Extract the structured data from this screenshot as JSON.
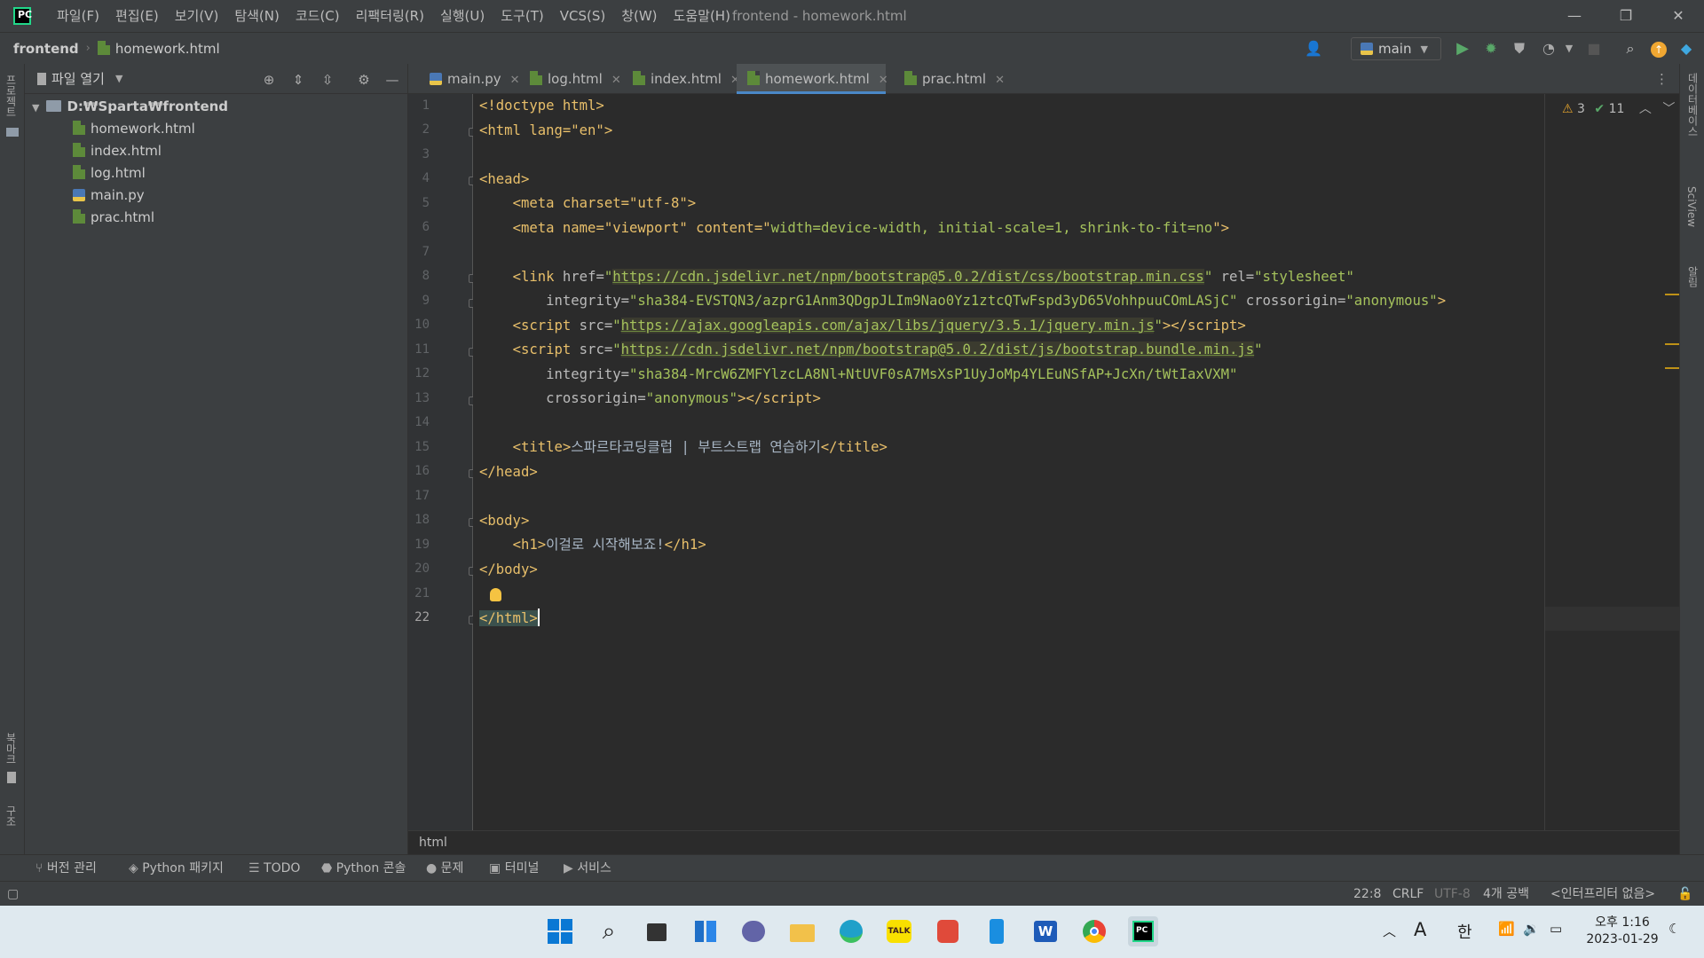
{
  "app": {
    "menu": [
      "파일(F)",
      "편집(E)",
      "보기(V)",
      "탐색(N)",
      "코드(C)",
      "리팩터링(R)",
      "실행(U)",
      "도구(T)",
      "VCS(S)",
      "창(W)",
      "도움말(H)"
    ],
    "window_title": "frontend - homework.html"
  },
  "navbar": {
    "project": "frontend",
    "file": "homework.html",
    "run_config": "main"
  },
  "project_panel": {
    "title": "파일 열기",
    "root": "D:₩Sparta₩frontend",
    "files": [
      "homework.html",
      "index.html",
      "log.html",
      "main.py",
      "prac.html"
    ]
  },
  "tabs": [
    {
      "label": "main.py",
      "type": "py"
    },
    {
      "label": "log.html",
      "type": "html"
    },
    {
      "label": "index.html",
      "type": "html"
    },
    {
      "label": "homework.html",
      "type": "html",
      "active": true
    },
    {
      "label": "prac.html",
      "type": "html"
    }
  ],
  "inspections": {
    "warnings": "3",
    "ok": "11"
  },
  "code": {
    "l1": "<!doctype html>",
    "l2": "<html lang=\"en\">",
    "l4": "<head>",
    "l5": "<meta charset=\"utf-8\">",
    "l6a": "<meta name=\"viewport\" content=\"",
    "l6b": "width=device-width, initial-scale=1, shrink-to-fit=no",
    "l8_url": "https://cdn.jsdelivr.net/npm/bootstrap@5.0.2/dist/css/bootstrap.min.css",
    "l9_hash": "sha384-EVSTQN3/azprG1Anm3QDgpJLIm9Nao0Yz1ztcQTwFspd3yD65VohhpuuCOmLASjC",
    "l10_url": "https://ajax.googleapis.com/ajax/libs/jquery/3.5.1/jquery.min.js",
    "l11_url": "https://cdn.jsdelivr.net/npm/bootstrap@5.0.2/dist/js/bootstrap.bundle.min.js",
    "l12_hash": "sha384-MrcW6ZMFYlzcLA8Nl+NtUVF0sA7MsXsP1UyJoMp4YLEuNSfAP+JcXn/tWtIaxVXM",
    "l15_text": "스파르타코딩클럽 | 부트스트랩 연습하기",
    "l16": "</head>",
    "l18": "<body>",
    "l19_text": "이걸로 시작해보죠!",
    "l20": "</body>",
    "l22": "</html>"
  },
  "editor_breadcrumb": "html",
  "tool_windows": [
    "버전 관리",
    "Python 패키지",
    "TODO",
    "Python 콘솔",
    "문제",
    "터미널",
    "서비스"
  ],
  "status": {
    "position": "22:8",
    "line_sep": "CRLF",
    "encoding": "UTF-8",
    "indent": "4개 공백",
    "interpreter": "<인터프리터 없음>"
  },
  "left_strip": {
    "project": "프로젝트",
    "bookmarks": "북마크",
    "structure": "구조"
  },
  "right_strip": {
    "database": "데이터베이스",
    "sciview": "SciView",
    "notifications": "알림"
  },
  "taskbar": {
    "time": "오후 1:16",
    "date": "2023-01-29",
    "ime_a": "A",
    "ime_han": "한"
  }
}
